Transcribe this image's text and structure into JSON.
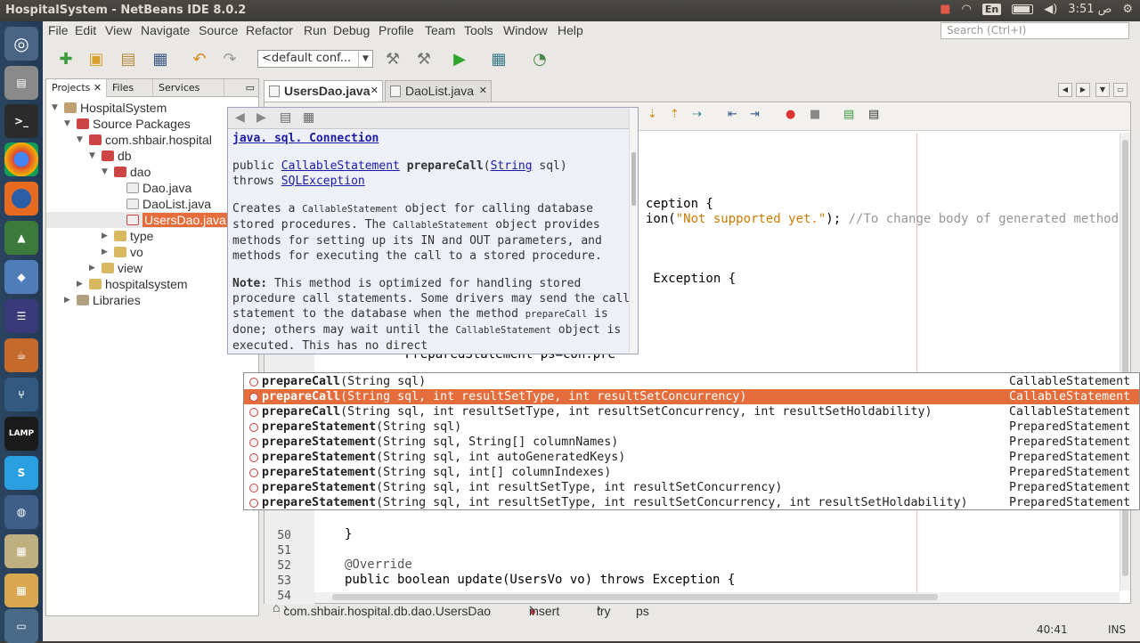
{
  "topbar": {
    "title": "HospitalSystem - NetBeans IDE 8.0.2",
    "lang": "En",
    "time": "3:51 ص"
  },
  "launcher": {
    "lamp_label": "LAMP"
  },
  "menu": [
    "File",
    "Edit",
    "View",
    "Navigate",
    "Source",
    "Refactor",
    "Run",
    "Debug",
    "Profile",
    "Team",
    "Tools",
    "Window",
    "Help"
  ],
  "search": {
    "placeholder": "Search (Ctrl+I)"
  },
  "toolbar": {
    "config": "<default conf..."
  },
  "project_tabs": [
    "Projects",
    "Files",
    "Services"
  ],
  "tree": [
    "HospitalSystem",
    "Source Packages",
    "com.shbair.hospital",
    "db",
    "dao",
    "Dao.java",
    "DaoList.java",
    "UsersDao.java",
    "type",
    "vo",
    "view",
    "hospitalsystem",
    "Libraries"
  ],
  "editor_tabs": [
    "UsersDao.java",
    "DaoList.java"
  ],
  "code": {
    "l1": "ception {",
    "l2_a": "ion(",
    "l2_str": "\"Not supported yet.\"",
    "l2_b": "); ",
    "l2_cmt": "//To change body of generated method",
    "l3": " Exception {",
    "line40_num": "40",
    "line40": "PreparedStatement ps=con.pre",
    "line50_num": "50",
    "line51_num": "51",
    "line52_num": "52",
    "line52": "}",
    "line53_num": "53",
    "line54_num": "54",
    "line54": "@Override",
    "line55": "public boolean update(UsersVo vo) throws Exception {"
  },
  "javadoc": {
    "cls": "java. sql. Connection",
    "sig_public": "public ",
    "sig_type": "CallableStatement",
    "sig_method": "prepareCall",
    "sig_paren": "(",
    "sig_param_type": "String",
    "sig_param": " sql)",
    "sig_throws": "throws ",
    "sig_exc": "SQLException",
    "p1a": "Creates a ",
    "p1b": "CallableStatement",
    "p1c": " object for calling database stored procedures. The ",
    "p1d": "CallableStatement",
    "p1e": " object provides methods for setting up its IN and OUT parameters, and methods for executing the call to a stored procedure.",
    "note_label": "Note:",
    "p2a": " This method is optimized for handling stored procedure call statements. Some drivers may send the call statement to the database when the method ",
    "p2b": "prepareCall",
    "p2c": " is done; others may wait until the ",
    "p2d": "CallableStatement",
    "p2e": " object is executed. This has no direct"
  },
  "completion": [
    {
      "name": "prepareCall",
      "args": "(String sql)",
      "ret": "CallableStatement"
    },
    {
      "name": "prepareCall",
      "args": "(String sql, int resultSetType, int resultSetConcurrency)",
      "ret": "CallableStatement"
    },
    {
      "name": "prepareCall",
      "args": "(String sql, int resultSetType, int resultSetConcurrency, int resultSetHoldability)",
      "ret": "CallableStatement"
    },
    {
      "name": "prepareStatement",
      "args": "(String sql)",
      "ret": "PreparedStatement"
    },
    {
      "name": "prepareStatement",
      "args": "(String sql, String[] columnNames)",
      "ret": "PreparedStatement"
    },
    {
      "name": "prepareStatement",
      "args": "(String sql, int autoGeneratedKeys)",
      "ret": "PreparedStatement"
    },
    {
      "name": "prepareStatement",
      "args": "(String sql, int[] columnIndexes)",
      "ret": "PreparedStatement"
    },
    {
      "name": "prepareStatement",
      "args": "(String sql, int resultSetType, int resultSetConcurrency)",
      "ret": "PreparedStatement"
    },
    {
      "name": "prepareStatement",
      "args": "(String sql, int resultSetType, int resultSetConcurrency, int resultSetHoldability)",
      "ret": "PreparedStatement"
    }
  ],
  "breadcrumbs": [
    "com.shbair.hospital.db.dao.UsersDao",
    "insert",
    "try",
    "ps"
  ],
  "status": {
    "position": "40:41",
    "mode": "INS"
  },
  "colors": {
    "selection": "#e56d3b",
    "string": "#ce7b00",
    "comment": "#969696",
    "launcher": "#2b4460"
  }
}
